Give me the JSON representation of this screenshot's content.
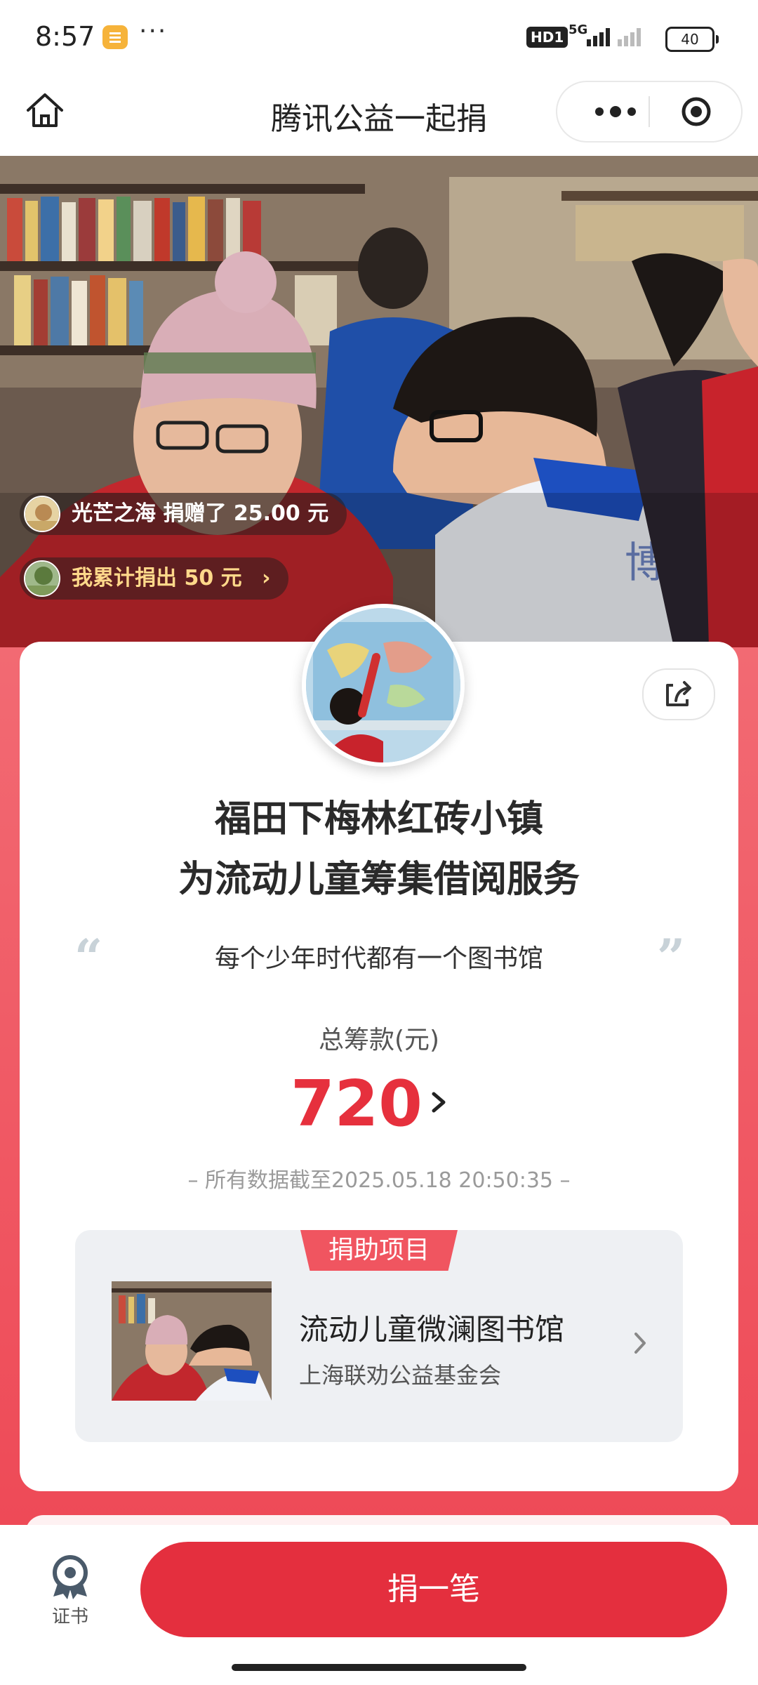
{
  "status_bar": {
    "time": "8:57",
    "more": "···",
    "hd": "HD1",
    "network": "5G",
    "battery": "40"
  },
  "nav": {
    "title": "腾讯公益一起捐",
    "home_icon": "home-icon",
    "more_icon": "more-dots-icon",
    "close_icon": "target-circle-icon"
  },
  "donation_feed": {
    "latest": {
      "name": "光芒之海",
      "action": "捐赠了 25.00 元"
    },
    "mine": {
      "text": "我累计捐出 50 元",
      "arrow": "›"
    }
  },
  "project": {
    "title_line1": "福田下梅林红砖小镇",
    "title_line2": "为流动儿童筹集借阅服务",
    "quote_open": "“",
    "slogan": "每个少年时代都有一个图书馆",
    "quote_close": "”",
    "total_label": "总筹款(元)",
    "total_amount": "720",
    "timestamp": "– 所有数据截至2025.05.18 20:50:35 –"
  },
  "support": {
    "tag": "捐助项目",
    "name": "流动儿童微澜图书馆",
    "org": "上海联劝公益基金会"
  },
  "bottom": {
    "cert_label": "证书",
    "donate_button": "捐一笔"
  },
  "colors": {
    "accent_red": "#e42f3e",
    "amount_red": "#e6303d",
    "pink_background": "#f26a73"
  }
}
